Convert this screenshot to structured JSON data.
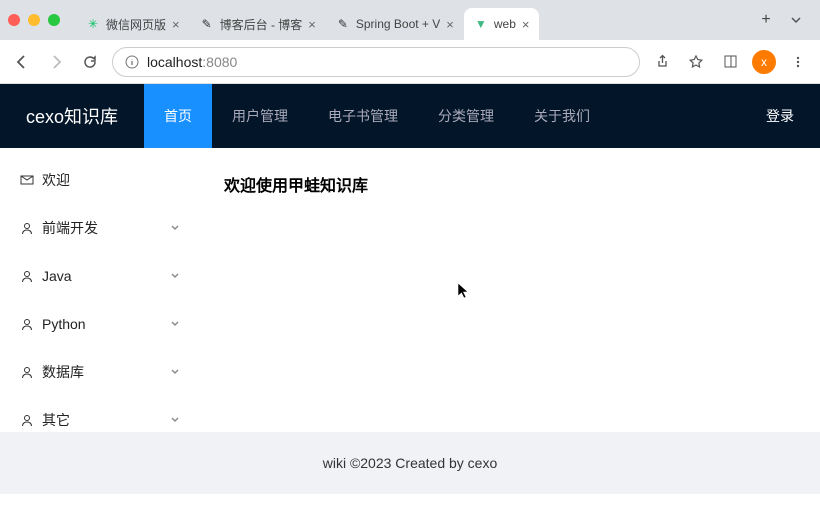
{
  "browser": {
    "traffic": {
      "close": "#ff5f57",
      "min": "#febc2e",
      "max": "#28c840"
    },
    "tabs": [
      {
        "title": "微信网页版",
        "favColor": "#07c160",
        "favText": "✳"
      },
      {
        "title": "博客后台 - 博客",
        "favColor": "#333",
        "favText": "✎"
      },
      {
        "title": "Spring Boot + V",
        "favColor": "#333",
        "favText": "✎"
      },
      {
        "title": "web",
        "favColor": "#41b883",
        "favText": "▼"
      }
    ],
    "url": {
      "host": "localhost",
      "port": ":8080"
    },
    "avatar": "x"
  },
  "app": {
    "brand": "cexo知识库",
    "nav": [
      {
        "label": "首页",
        "active": true
      },
      {
        "label": "用户管理"
      },
      {
        "label": "电子书管理"
      },
      {
        "label": "分类管理"
      },
      {
        "label": "关于我们"
      }
    ],
    "login": "登录",
    "sidebar": [
      {
        "label": "欢迎",
        "icon": "mail",
        "expandable": false
      },
      {
        "label": "前端开发",
        "icon": "user",
        "expandable": true
      },
      {
        "label": "Java",
        "icon": "user",
        "expandable": true
      },
      {
        "label": "Python",
        "icon": "user",
        "expandable": true
      },
      {
        "label": "数据库",
        "icon": "user",
        "expandable": true
      },
      {
        "label": "其它",
        "icon": "user",
        "expandable": true
      }
    ],
    "welcome": "欢迎使用甲蛙知识库",
    "footer": "wiki ©2023 Created by cexo"
  }
}
